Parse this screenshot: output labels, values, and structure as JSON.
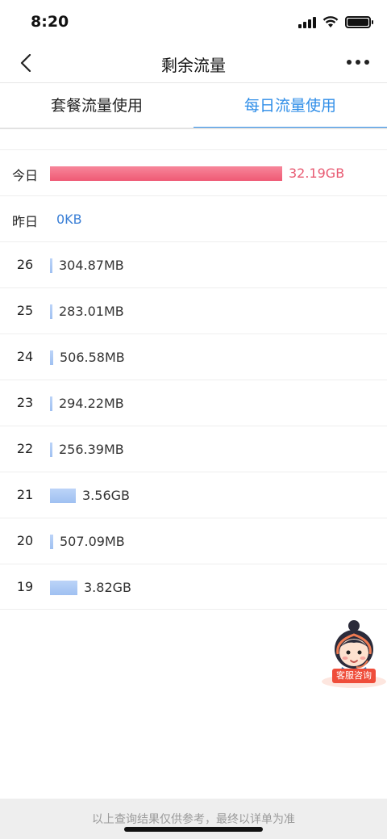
{
  "status": {
    "time": "8:20"
  },
  "nav": {
    "title": "剩余流量"
  },
  "tabs": [
    {
      "label": "套餐流量使用",
      "active": false
    },
    {
      "label": "每日流量使用",
      "active": true
    }
  ],
  "daily_usage": [
    {
      "day": "今日",
      "value": "32.19GB",
      "bar_fraction": 1.0,
      "style": "red"
    },
    {
      "day": "昨日",
      "value": "0KB",
      "bar_fraction": 0,
      "style": "blue"
    },
    {
      "day": "26",
      "value": "304.87MB",
      "bar_fraction": 0.009,
      "style": "normal"
    },
    {
      "day": "25",
      "value": "283.01MB",
      "bar_fraction": 0.009,
      "style": "normal"
    },
    {
      "day": "24",
      "value": "506.58MB",
      "bar_fraction": 0.015,
      "style": "normal"
    },
    {
      "day": "23",
      "value": "294.22MB",
      "bar_fraction": 0.009,
      "style": "normal"
    },
    {
      "day": "22",
      "value": "256.39MB",
      "bar_fraction": 0.008,
      "style": "normal"
    },
    {
      "day": "21",
      "value": "3.56GB",
      "bar_fraction": 0.111,
      "style": "normal"
    },
    {
      "day": "20",
      "value": "507.09MB",
      "bar_fraction": 0.015,
      "style": "normal"
    },
    {
      "day": "19",
      "value": "3.82GB",
      "bar_fraction": 0.119,
      "style": "normal"
    }
  ],
  "customer_service": {
    "label": "客服咨询",
    "icon": "customer-service-avatar-icon"
  },
  "footer": {
    "note": "以上查询结果仅供参考，最终以详单为准"
  },
  "colors": {
    "accent": "#2f8ee8",
    "today_bar": "#ef5a75",
    "bar": "#a9c6f3"
  }
}
